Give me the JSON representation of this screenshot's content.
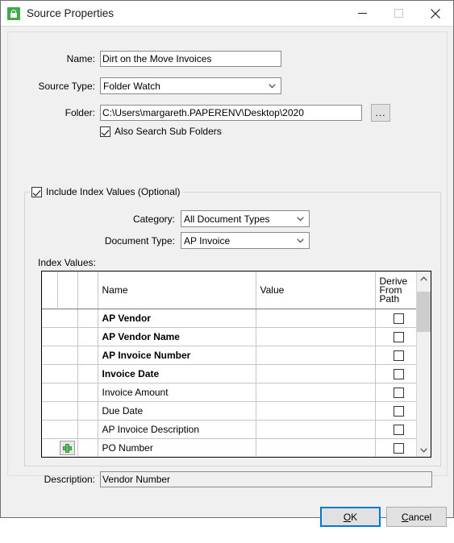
{
  "window": {
    "title": "Source Properties",
    "icon": "source-lock-icon",
    "controls": {
      "minimize": "minimize-icon",
      "maximize": "maximize-icon",
      "close": "close-icon"
    }
  },
  "form": {
    "name_label": "Name:",
    "name_value": "Dirt on the Move Invoices",
    "source_type_label": "Source Type:",
    "source_type_value": "Folder Watch",
    "folder_label": "Folder:",
    "folder_value": "C:\\Users\\margareth.PAPERENV\\Desktop\\2020",
    "browse_label": "...",
    "sub_folders_label": "Also Search Sub Folders",
    "sub_folders_checked": true
  },
  "index_group": {
    "legend": "Include Index Values (Optional)",
    "legend_checked": true,
    "category_label": "Category:",
    "category_value": "All Document Types",
    "document_type_label": "Document Type:",
    "document_type_value": "AP Invoice",
    "grid_label": "Index Values:"
  },
  "grid": {
    "columns": [
      "",
      "",
      "",
      "Name",
      "Value",
      "Derive From Path"
    ],
    "derive_header_lines": [
      "Derive",
      "From",
      "Path"
    ],
    "rows": [
      {
        "name": "AP Vendor",
        "bold": true,
        "value": "",
        "value_state": "selected",
        "derive": false,
        "add_button": false
      },
      {
        "name": "AP Vendor Name",
        "bold": true,
        "value": "",
        "value_state": "green",
        "derive": false,
        "add_button": false
      },
      {
        "name": "AP Invoice Number",
        "bold": true,
        "value": "",
        "value_state": "green",
        "derive": false,
        "add_button": false
      },
      {
        "name": "Invoice Date",
        "bold": true,
        "value": "",
        "value_state": "empty",
        "derive": false,
        "add_button": false
      },
      {
        "name": "Invoice Amount",
        "bold": false,
        "value": "",
        "value_state": "empty",
        "derive": false,
        "add_button": false
      },
      {
        "name": "Due Date",
        "bold": false,
        "value": "",
        "value_state": "empty",
        "derive": false,
        "add_button": false
      },
      {
        "name": "AP Invoice Description",
        "bold": false,
        "value": "",
        "value_state": "green",
        "derive": false,
        "add_button": false
      },
      {
        "name": "PO Number",
        "bold": false,
        "value": "",
        "value_state": "green",
        "derive": false,
        "add_button": true
      },
      {
        "name": "",
        "bold": false,
        "value": "",
        "value_state": "green",
        "derive": false,
        "add_button": true
      }
    ],
    "scrollbar": {
      "up": "scroll-up-arrow",
      "down": "scroll-down-arrow"
    }
  },
  "description": {
    "label": "Description:",
    "value": "Vendor Number"
  },
  "footer": {
    "ok_label": "OK",
    "ok_accel": "O",
    "cancel_label": "Cancel",
    "cancel_accel": "C"
  },
  "colors": {
    "selection_blue": "#0078d4",
    "required_green": "#d1f5c4",
    "accent": "#0078d4",
    "icon_green": "#3faa4b"
  }
}
